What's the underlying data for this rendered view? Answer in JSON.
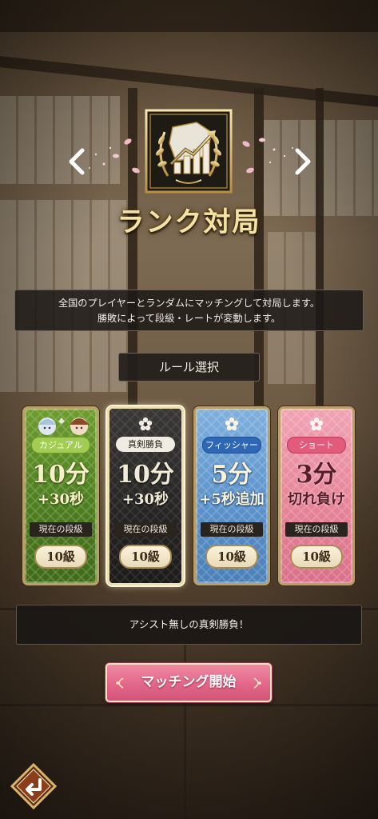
{
  "header": {
    "title": "ランク対局"
  },
  "description": {
    "line1": "全国のプレイヤーとランダムにマッチングして対局します。",
    "line2": "勝敗によって段級・レートが変動します。"
  },
  "rule_select_label": "ルール選択",
  "modes": [
    {
      "name": "カジュアル",
      "time_main": "10分",
      "time_extra": "+30秒",
      "rank_label": "現在の段級",
      "rank": "10級",
      "color": "#4d7e1f"
    },
    {
      "name": "真剣勝負",
      "time_main": "10分",
      "time_extra": "+30秒",
      "rank_label": "現在の段級",
      "rank": "10級",
      "color": "#262524",
      "selected": true
    },
    {
      "name": "フィッシャー",
      "time_main": "5分",
      "time_extra": "+5秒追加",
      "rank_label": "現在の段級",
      "rank": "10級",
      "color": "#5c93cb"
    },
    {
      "name": "ショート",
      "time_main": "3分",
      "time_extra": "切れ負け",
      "rank_label": "現在の段級",
      "rank": "10級",
      "color": "#e68498"
    }
  ],
  "info_text": "アシスト無しの真剣勝負！",
  "match_button": "マッチング開始",
  "icons": {
    "prev": "chevron-left-icon",
    "next": "chevron-right-icon",
    "emblem": "rank-laurel-chart-icon",
    "back": "back-arrow-icon"
  },
  "colors": {
    "gold": "#f5e3a6",
    "pink_button": "#e3678a"
  }
}
